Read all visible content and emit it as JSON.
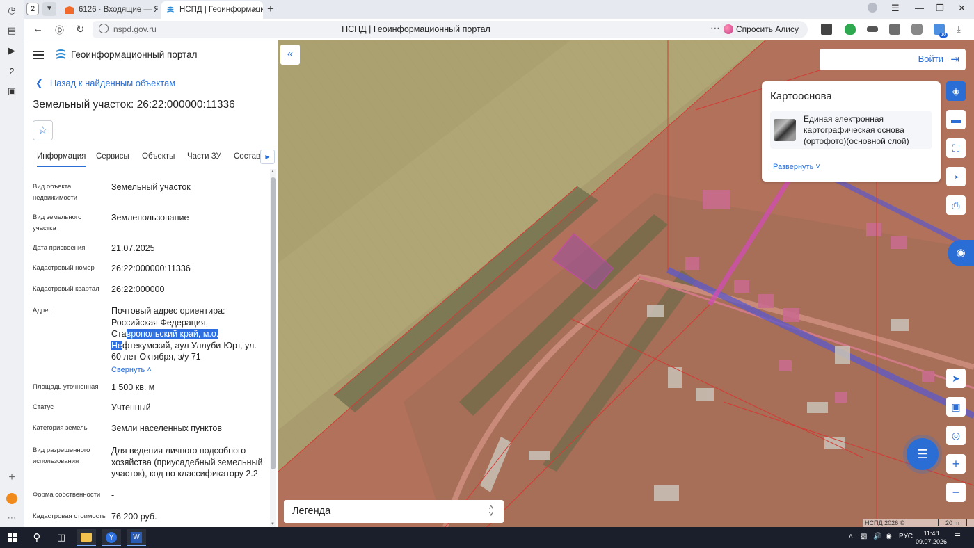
{
  "browser": {
    "tab_count": "2",
    "tabs": [
      {
        "title": "6126 · Входящие — Яндек"
      },
      {
        "title": "НСПД | Геоинформацио"
      }
    ],
    "url": "nspd.gov.ru",
    "page_title": "НСПД | Геоинформационный портал",
    "alice_label": "Спросить Алису AI",
    "ext_badge": "10"
  },
  "site": {
    "title": "Геоинформационный портал",
    "back_link": "Назад к найденным объектам",
    "object_title": "Земельный участок: 26:22:000000:11336",
    "tabs": [
      "Информация",
      "Сервисы",
      "Объекты",
      "Части ЗУ",
      "Состав"
    ],
    "rows": [
      {
        "label": "Вид объекта недвижимости",
        "value": "Земельный участок"
      },
      {
        "label": "Вид земельного участка",
        "value": "Землепользование"
      },
      {
        "label": "Дата присвоения",
        "value": "21.07.2025"
      },
      {
        "label": "Кадастровый номер",
        "value": "26:22:000000:11336"
      },
      {
        "label": "Кадастровый квартал",
        "value": "26:22:000000"
      },
      {
        "label": "Адрес",
        "value_parts": {
          "p1": "Почтовый адрес ориентира: Российская Федерация, Ста",
          "sel1": "вропольский край, м.о.",
          "sel2": "Не",
          "p2": "фтекумский, аул Уллуби-Юрт, ул. 60 лет Октября, з/у 71"
        },
        "collapse": "Свернуть"
      },
      {
        "label": "Площадь уточненная",
        "value": "1 500 кв. м"
      },
      {
        "label": "Статус",
        "value": "Учтенный"
      },
      {
        "label": "Категория земель",
        "value": "Земли населенных пунктов"
      },
      {
        "label": "Вид разрешенного использования",
        "value": "Для ведения личного подсобного хозяйства (приусадебный земельный участок), код по классификатору 2.2"
      },
      {
        "label": "Форма собственности",
        "value": "-"
      },
      {
        "label": "Кадастровая стоимость",
        "value": "76 200 руб."
      }
    ]
  },
  "map": {
    "login_label": "Войти",
    "basemap_title": "Картооснова",
    "basemap_item": "Единая электронная картографическая основа (ортофото)(основной слой)",
    "expand_label": "Развернуть",
    "legend_label": "Легенда",
    "copyright": "НСПД 2026 ©",
    "scale": "20 m"
  },
  "taskbar": {
    "lang": "РУС",
    "time": "11:48",
    "date": "09.07.2026"
  }
}
